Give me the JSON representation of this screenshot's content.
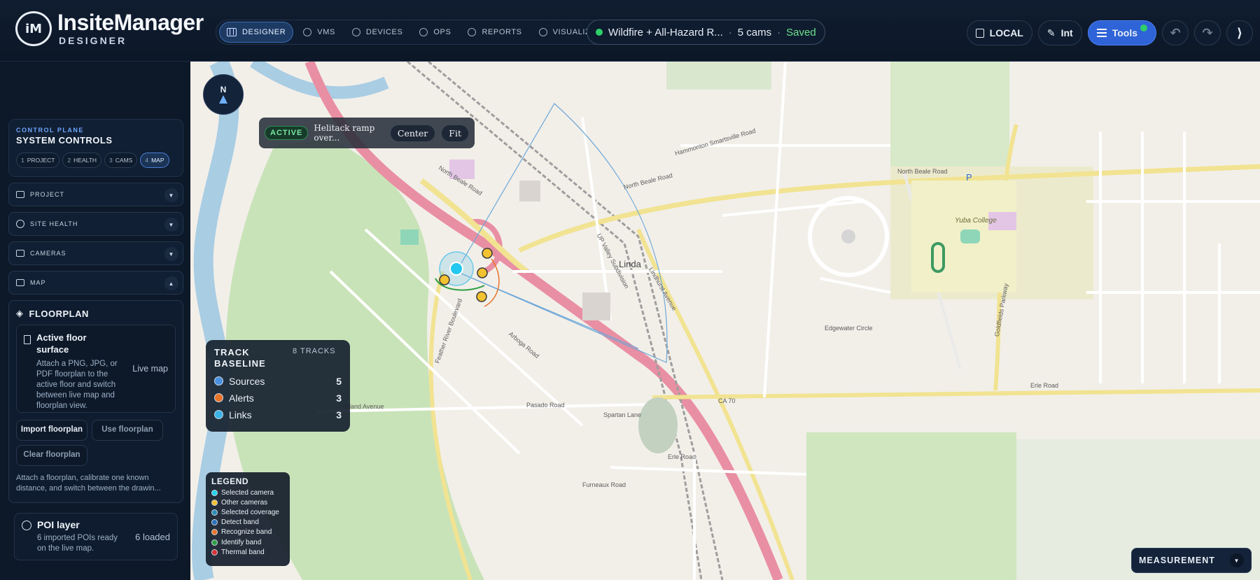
{
  "brand": {
    "logo_text": "iM",
    "name": "InsiteManager",
    "subtitle": "DESIGNER"
  },
  "nav": {
    "tabs": [
      {
        "label": "DESIGNER",
        "active": true
      },
      {
        "label": "VMS"
      },
      {
        "label": "DEVICES"
      },
      {
        "label": "OPS"
      },
      {
        "label": "REPORTS"
      },
      {
        "label": "VISUALIZE"
      }
    ]
  },
  "project": {
    "name": "Wildfire + All-Hazard R...",
    "cams": "5 cams",
    "status": "Saved",
    "status_color": "#2fcf6a"
  },
  "toolbar": {
    "local_label": "LOCAL",
    "int_label": "Int",
    "tools_label": "Tools",
    "undo_icon": "undo-icon",
    "redo_icon": "redo-icon",
    "collapse_glyph": "⟩"
  },
  "sidebar": {
    "control_plane": {
      "kicker": "CONTROL PLANE",
      "title": "SYSTEM CONTROLS",
      "steps": [
        {
          "n": "1",
          "label": "PROJECT"
        },
        {
          "n": "2",
          "label": "HEALTH"
        },
        {
          "n": "3",
          "label": "CAMS"
        },
        {
          "n": "4",
          "label": "MAP",
          "active": true
        }
      ]
    },
    "sections": [
      {
        "label": "PROJECT",
        "icon": "folder-icon"
      },
      {
        "label": "SITE HEALTH",
        "icon": "check-circle-icon"
      },
      {
        "label": "CAMERAS",
        "icon": "camera-icon"
      },
      {
        "label": "MAP",
        "icon": "map-icon"
      }
    ],
    "floorplan": {
      "title": "FLOORPLAN",
      "card_title": "Active floor surface",
      "card_desc": "Attach a PNG, JPG, or PDF floorplan to the active floor and switch between live map and floorplan view.",
      "mode": "Live map",
      "import_label": "Import floorplan",
      "use_label": "Use floorplan",
      "clear_label": "Clear floorplan",
      "footer": "Attach a floorplan, calibrate one known distance, and switch between the drawin..."
    },
    "poi": {
      "title": "POI layer",
      "desc": "6 imported POIs ready on the live map.",
      "count": "6 loaded"
    }
  },
  "map": {
    "compass_label": "N",
    "active": {
      "chip": "ACTIVE",
      "text": "Helitack ramp over...",
      "center_label": "Center",
      "fit_label": "Fit"
    },
    "track": {
      "title": "TRACK BASELINE",
      "count": "8 TRACKS",
      "rows": [
        {
          "label": "Sources",
          "value": "5",
          "color": "#4a90e2"
        },
        {
          "label": "Alerts",
          "value": "3",
          "color": "#e8742a"
        },
        {
          "label": "Links",
          "value": "3",
          "color": "#3bb2e8"
        }
      ]
    },
    "legend": {
      "title": "LEGEND",
      "items": [
        {
          "label": "Selected camera",
          "color": "#22d3ee"
        },
        {
          "label": "Other cameras",
          "color": "#f2c230"
        },
        {
          "label": "Selected coverage",
          "color": "#2b8bb8"
        },
        {
          "label": "Detect band",
          "color": "#2a6fb8"
        },
        {
          "label": "Recognize band",
          "color": "#e8742a"
        },
        {
          "label": "Identify band",
          "color": "#2f9e44"
        },
        {
          "label": "Thermal band",
          "color": "#d63131"
        }
      ]
    },
    "measurement_label": "MEASUREMENT",
    "labels": {
      "linda": "Linda",
      "yuba_college": "Yuba College",
      "north_beale_1": "North Beale Road",
      "north_beale_2": "North Beale Road",
      "north_beale_3": "North Beale Road",
      "erle": "Erle Road",
      "erle_2": "Erle Road",
      "ca70": "CA 70",
      "lindhurst": "Lindhurst Avenue",
      "arboga": "Arboga Road",
      "feather": "Feather River Boulevard",
      "island": "Island Avenue",
      "pasado": "Pasado Road",
      "edgewater": "Edgewater Circle",
      "goldfields": "Goldfields Parkway",
      "hammonton": "Hammonton Smartsville Road",
      "up_valley": "UP Valley Subdivision",
      "spartan": "Spartan Lane",
      "furneaux": "Furneaux Road",
      "p": "P"
    }
  }
}
